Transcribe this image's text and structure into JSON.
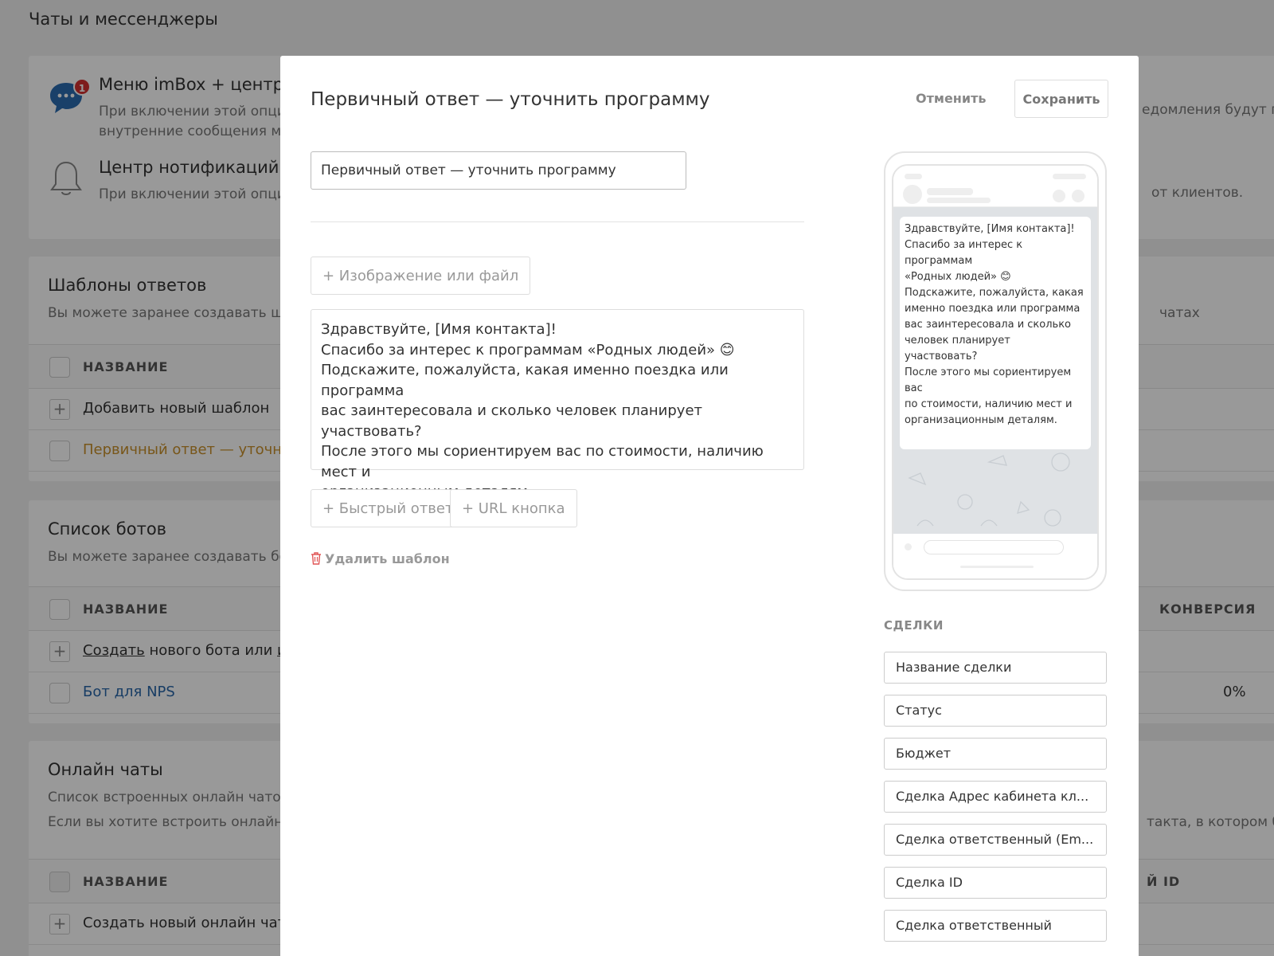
{
  "page": {
    "title": "Чаты и мессенджеры"
  },
  "features": {
    "imbox": {
      "title": "Меню imBox + центр",
      "desc_line1": "При включении этой опци",
      "desc_line2": "внутренние сообщения м",
      "right_fragment": "едомления будут пр",
      "badge": "1"
    },
    "notify": {
      "title": "Центр нотификаций",
      "desc": "При включении этой опци",
      "right_fragment": "от клиентов."
    }
  },
  "templates": {
    "title": "Шаблоны ответов",
    "desc": "Вы можете заранее создавать ша",
    "right_fragment": "чатах",
    "col_name": "НАЗВАНИЕ",
    "add_label": "Добавить новый шаблон",
    "row1_label": "Первичный ответ — уточнит"
  },
  "bots": {
    "title": "Список ботов",
    "desc": "Вы можете заранее создавать бо",
    "col_name": "НАЗВАНИЕ",
    "col_conversion": "КОНВЕРСИЯ",
    "create_link": "Создать",
    "create_mid": " нового бота или ",
    "create_tail": "им",
    "row1_label": "Бот для NPS",
    "row1_conversion": "0%"
  },
  "online_chats": {
    "title": "Онлайн чаты",
    "desc_line1": "Список встроенных онлайн чатов",
    "desc_line2": "Если вы хотите встроить онлайн",
    "right_fragment": "такта, в котором буд",
    "col_name": "НАЗВАНИЕ",
    "col_id": "Й ID",
    "create_label": "Создать новый онлайн чат"
  },
  "modal": {
    "title": "Первичный ответ — уточнить программу",
    "cancel_label": "Отменить",
    "save_label": "Сохранить",
    "name_value": "Первичный ответ — уточнить программу",
    "attach_label": "+ Изображение или файл",
    "message_text": "Здравствуйте, [Имя контакта]!\nСпасибо за интерес к программам «Родных людей» 😊\nПодскажите, пожалуйста, какая именно поездка или программа\nвас заинтересовала и сколько человек планирует участвовать?\nПосле этого мы сориентируем вас по стоимости, наличию мест и\nорганизационным деталям.",
    "quick_reply_label": "+ Быстрый ответ",
    "url_button_label": "+ URL кнопка",
    "delete_label": "Удалить шаблон",
    "preview_text": "Здравствуйте, [Имя контакта]!\nСпасибо за интерес к программам\n«Родных людей» 😊\nПодскажите, пожалуйста, какая\nименно поездка или программа\nвас заинтересовала и сколько\nчеловек планирует участвовать?\nПосле этого мы сориентируем вас\nпо стоимости, наличию мест и\nорганизационным деталям.",
    "deals_label": "СДЕЛКИ",
    "deal_fields": [
      "Название сделки",
      "Статус",
      "Бюджет",
      "Сделка Адрес кабинета кл...",
      "Сделка ответственный (Em...",
      "Сделка ID",
      "Сделка ответственный"
    ]
  },
  "colors": {
    "accent_orange": "#c8902a",
    "link_blue": "#2866a8",
    "badge_red": "#d32f2f",
    "chat_icon_blue": "#2b6cb0"
  }
}
